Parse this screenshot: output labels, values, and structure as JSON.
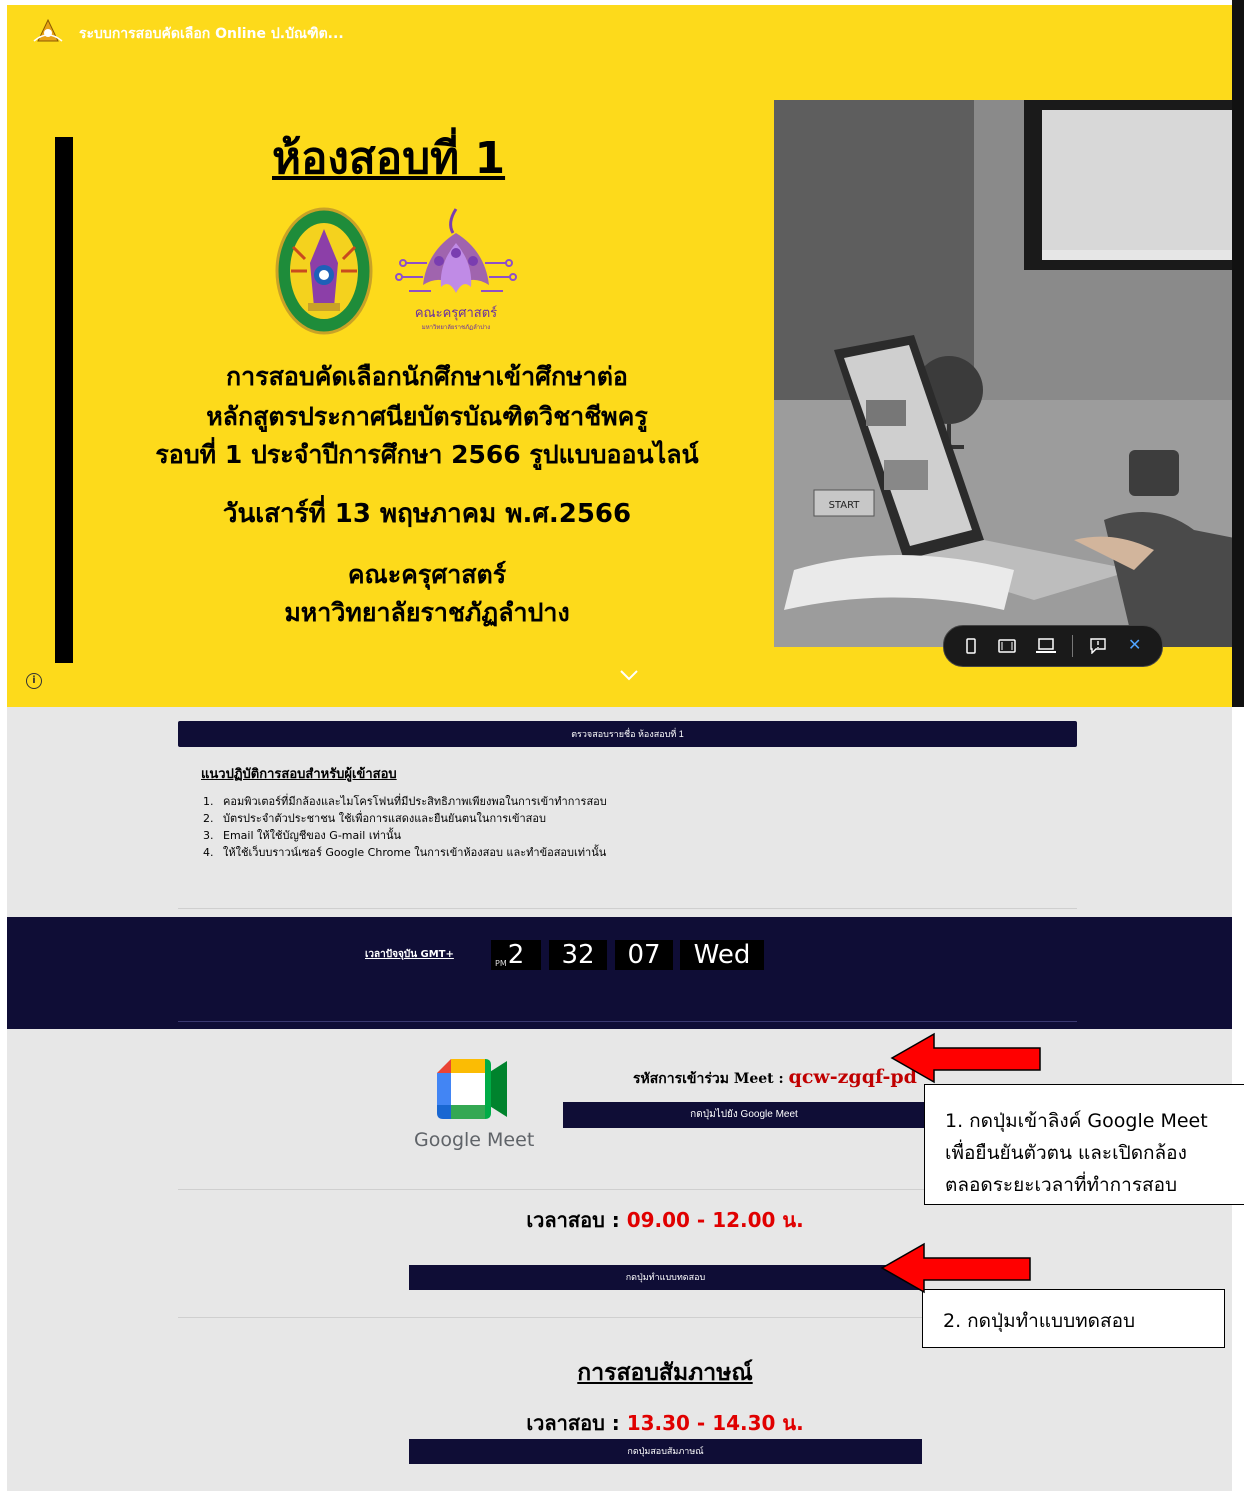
{
  "header": {
    "site_title": "ระบบการสอบคัดเลือก Online ป.บัณฑิต..."
  },
  "hero": {
    "room_title": "ห้องสอบที่ 1",
    "faculty_logo_text": "คณะครุศาสตร์",
    "faculty_logo_subtext": "มหาวิทยาลัยราชภัฏลำปาง",
    "seal_text": "LAMPANG RAJABHAT UNIVERSITY",
    "line1": "การสอบคัดเลือกนักศึกษาเข้าศึกษาต่อ",
    "line2": "หลักสูตรประกาศนียบัตรบัณฑิตวิชาชีพครู",
    "line3": "รอบที่ 1 ประจำปีการศึกษา 2566 รูปแบบออนไลน์",
    "date": "วันเสาร์ที่ 13 พฤษภาคม พ.ศ.2566",
    "faculty": "คณะครุศาสตร์",
    "university": "มหาวิทยาลัยราชภัฏลำปาง",
    "photo_book_label": "START"
  },
  "preview_toolbar": {
    "icons": [
      "mobile-view-icon",
      "tablet-view-icon",
      "desktop-view-icon",
      "feedback-icon",
      "close-icon"
    ],
    "close_glyph": "✕"
  },
  "instructions": {
    "check_list_button": "ตรวจสอบรายชื่อ ห้องสอบที่ 1",
    "heading": "แนวปฏิบัติการสอบสำหรับผู้เข้าสอบ",
    "rules": [
      {
        "num": "1.",
        "text": "คอมพิวเตอร์ที่มีกล้องและไมโครโฟนที่มีประสิทธิภาพเพียงพอในการเข้าทำการสอบ"
      },
      {
        "num": "2.",
        "text": "บัตรประจำตัวประชาชน ใช้เพื่อการแสดงและยืนยันตนในการเข้าสอบ"
      },
      {
        "num": "3.",
        "text": "Email ให้ใช้บัญชีของ G-mail เท่านั้น"
      },
      {
        "num": "4.",
        "text": "ให้ใช้เว็บบราวน์เซอร์ Google Chrome ในการเข้าห้องสอบ และทำข้อสอบเท่านั้น"
      }
    ]
  },
  "clock": {
    "label": "เวลาปัจจุบัน GMT+",
    "ampm": "PM",
    "hour": "2",
    "minute": "32",
    "second": "07",
    "day": "Wed"
  },
  "meet": {
    "logo_text": "Google Meet",
    "code_label": "รหัสการเข้าร่วม Meet : ",
    "code_value": "qcw-zgqf-pd",
    "button": "กดปุ่มไปยัง Google Meet"
  },
  "exam": {
    "time_label": "เวลาสอบ : ",
    "time_value": "09.00 - 12.00 น.",
    "button": "กดปุ่มทำแบบทดสอบ"
  },
  "interview": {
    "heading": "การสอบสัมภาษณ์",
    "time_label": "เวลาสอบ : ",
    "time_value": "13.30 - 14.30 น.",
    "button": "กดปุ่มสอบสัมภาษณ์"
  },
  "callouts": {
    "first_line1": "1. กดปุ่มเข้าลิงค์ Google Meet",
    "first_line2": "เพื่อยืนยันตัวตน และเปิดกล้อง",
    "first_line3": "ตลอดระยะเวลาที่ทำการสอบ",
    "second": "2. กดปุ่มทำแบบทดสอบ"
  },
  "colors": {
    "hero_yellow": "#FDDA1B",
    "navy": "#0F0D36",
    "page_gray": "#E7E7E7",
    "accent_red": "#E00000",
    "arrow_red": "#FF0000"
  }
}
